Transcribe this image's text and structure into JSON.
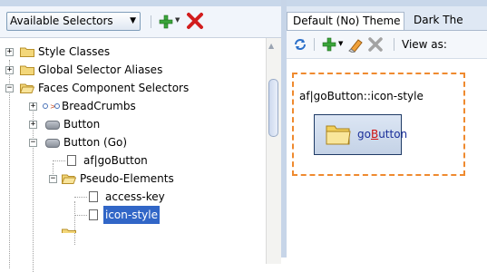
{
  "left_toolbar": {
    "dropdown_label": "Available Selectors",
    "dropdown_arrow": "▼",
    "add_icon": "green-plus-icon",
    "delete_icon": "red-x-icon"
  },
  "tree": {
    "items": [
      {
        "label": "Style Classes"
      },
      {
        "label": "Global Selector Aliases"
      },
      {
        "label": "Faces Component Selectors"
      },
      {
        "label": "BreadCrumbs"
      },
      {
        "label": "Button"
      },
      {
        "label": "Button (Go)"
      },
      {
        "label": "af|goButton"
      },
      {
        "label": "Pseudo-Elements"
      },
      {
        "label": "access-key"
      },
      {
        "label": "icon-style",
        "selected": true
      }
    ]
  },
  "right_pane": {
    "tabs": [
      {
        "label": "Default (No) Theme",
        "active": true
      },
      {
        "label": "Dark The"
      }
    ],
    "toolbar": {
      "view_as_label": "View as:"
    },
    "preview": {
      "selector_label": "af|goButton::icon-style",
      "button_text_prefix": "go",
      "button_access_key": "B",
      "button_text_suffix": "utton"
    }
  },
  "colors": {
    "selection": "#3166c7",
    "preview_border": "#ef8a2f",
    "toolbar_bg": "#f1f5fb",
    "tab_bar_bg": "#dfe8f4"
  }
}
